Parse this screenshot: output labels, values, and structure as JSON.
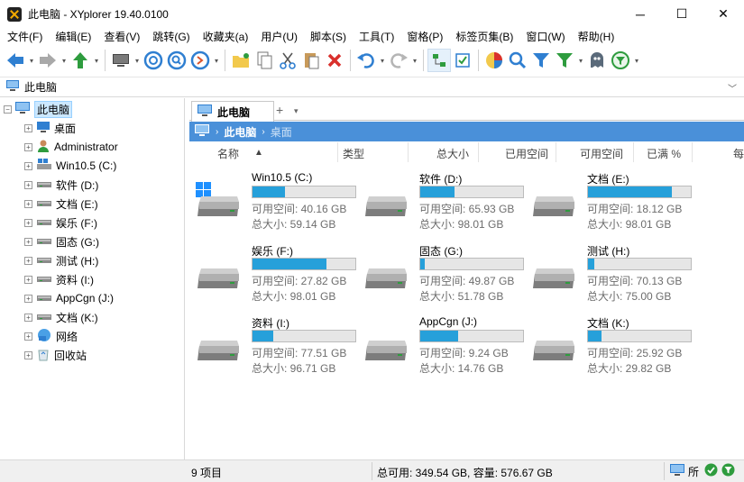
{
  "window": {
    "title": "此电脑 - XYplorer 19.40.0100",
    "controls": {
      "minimize": "─",
      "maximize": "☐",
      "close": "✕"
    }
  },
  "menu": [
    "文件(F)",
    "编辑(E)",
    "查看(V)",
    "跳转(G)",
    "收藏夹(a)",
    "用户(U)",
    "脚本(S)",
    "工具(T)",
    "窗格(P)",
    "标签页集(B)",
    "窗口(W)",
    "帮助(H)"
  ],
  "address": {
    "path": "此电脑"
  },
  "tree": {
    "root": "此电脑",
    "items": [
      {
        "label": "桌面",
        "icon": "desktop-icon"
      },
      {
        "label": "Administrator",
        "icon": "user-icon"
      },
      {
        "label": "Win10.5 (C:)",
        "icon": "windows-drive-icon"
      },
      {
        "label": "软件 (D:)",
        "icon": "drive-icon"
      },
      {
        "label": "文档 (E:)",
        "icon": "drive-icon"
      },
      {
        "label": "娱乐 (F:)",
        "icon": "drive-icon"
      },
      {
        "label": "固态 (G:)",
        "icon": "drive-icon"
      },
      {
        "label": "测试 (H:)",
        "icon": "drive-icon"
      },
      {
        "label": "资料 (I:)",
        "icon": "drive-icon"
      },
      {
        "label": "AppCgn (J:)",
        "icon": "drive-icon"
      },
      {
        "label": "文档 (K:)",
        "icon": "drive-icon"
      },
      {
        "label": "网络",
        "icon": "network-icon"
      },
      {
        "label": "回收站",
        "icon": "recycle-bin-icon"
      }
    ]
  },
  "tab": {
    "label": "此电脑",
    "add": "+",
    "dropdown": "▾"
  },
  "breadcrumb": {
    "current": "此电脑",
    "next": "桌面",
    "separator": "›"
  },
  "columns": [
    "名称",
    "类型",
    "总大小",
    "已用空间",
    "可用空间",
    "已满 %",
    "每"
  ],
  "drives": [
    {
      "name": "Win10.5 (C:)",
      "free": "可用空间: 40.16 GB",
      "total": "总大小: 59.14 GB",
      "used_pct": 32,
      "windows": true
    },
    {
      "name": "软件 (D:)",
      "free": "可用空间: 65.93 GB",
      "total": "总大小: 98.01 GB",
      "used_pct": 33
    },
    {
      "name": "文档 (E:)",
      "free": "可用空间: 18.12 GB",
      "total": "总大小: 98.01 GB",
      "used_pct": 82
    },
    {
      "name": "娱乐 (F:)",
      "free": "可用空间: 27.82 GB",
      "total": "总大小: 98.01 GB",
      "used_pct": 72
    },
    {
      "name": "固态 (G:)",
      "free": "可用空间: 49.87 GB",
      "total": "总大小: 51.78 GB",
      "used_pct": 4
    },
    {
      "name": "测试 (H:)",
      "free": "可用空间: 70.13 GB",
      "total": "总大小: 75.00 GB",
      "used_pct": 6
    },
    {
      "name": "资料 (I:)",
      "free": "可用空间: 77.51 GB",
      "total": "总大小: 96.71 GB",
      "used_pct": 20
    },
    {
      "name": "AppCgn (J:)",
      "free": "可用空间: 9.24 GB",
      "total": "总大小: 14.76 GB",
      "used_pct": 37
    },
    {
      "name": "文档 (K:)",
      "free": "可用空间: 25.92 GB",
      "total": "总大小: 29.82 GB",
      "used_pct": 13
    }
  ],
  "status": {
    "items": "9 项目",
    "space": "总可用: 349.54 GB, 容量: 576.67 GB",
    "right_label": "所"
  },
  "colors": {
    "accent": "#4a90d9",
    "bar": "#26a0da",
    "selection": "#cce8ff"
  }
}
